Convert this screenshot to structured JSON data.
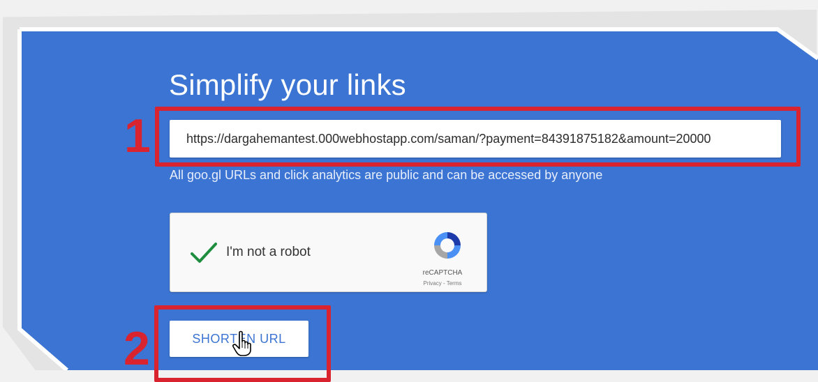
{
  "page": {
    "title": "Simplify your links",
    "notice": "All goo.gl URLs and click analytics are public and can be accessed by anyone"
  },
  "url_input": {
    "value": "https://dargahemantest.000webhostapp.com/saman/?payment=84391875182&amount=20000"
  },
  "captcha": {
    "label": "I'm not a robot",
    "brand": "reCAPTCHA",
    "links": "Privacy - Terms",
    "checked": true
  },
  "shorten_button": {
    "label": "SHORTEN URL"
  },
  "annotations": {
    "step1": "1",
    "step2": "2"
  },
  "colors": {
    "panel": "#3b74d2",
    "annotation": "#d92430",
    "check": "#1e8e3e"
  }
}
